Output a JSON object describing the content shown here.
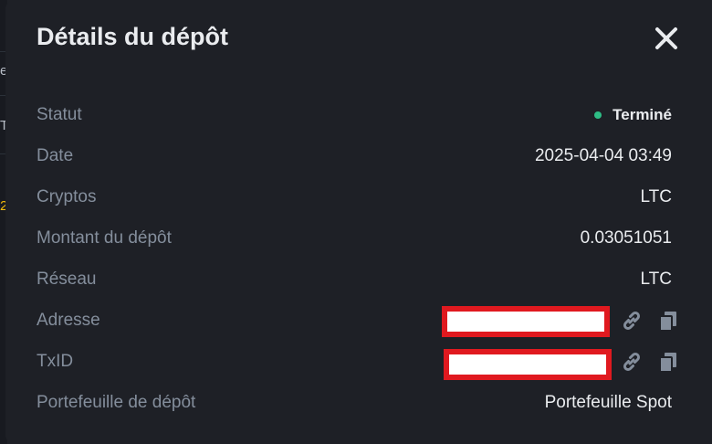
{
  "background_fragments": {
    "frag1": "e",
    "frag2": "T",
    "frag3": "2"
  },
  "modal": {
    "title": "Détails du dépôt",
    "close_icon": "close-icon"
  },
  "rows": {
    "status": {
      "label": "Statut",
      "value": "Terminé",
      "status_color": "#2ebd85"
    },
    "date": {
      "label": "Date",
      "value": "2025-04-04 03:49"
    },
    "crypto": {
      "label": "Cryptos",
      "value": "LTC"
    },
    "amount": {
      "label": "Montant du dépôt",
      "value": "0.03051051"
    },
    "network": {
      "label": "Réseau",
      "value": "LTC"
    },
    "address": {
      "label": "Adresse",
      "link_icon": "link-icon",
      "copy_icon": "copy-icon"
    },
    "txid": {
      "label": "TxID",
      "link_icon": "link-icon",
      "copy_icon": "copy-icon"
    },
    "wallet": {
      "label": "Portefeuille de dépôt",
      "value": "Portefeuille Spot"
    }
  },
  "colors": {
    "background": "#1e2026",
    "label": "#848e9c",
    "value": "#eaecef",
    "redaction_border": "#e0191f"
  }
}
